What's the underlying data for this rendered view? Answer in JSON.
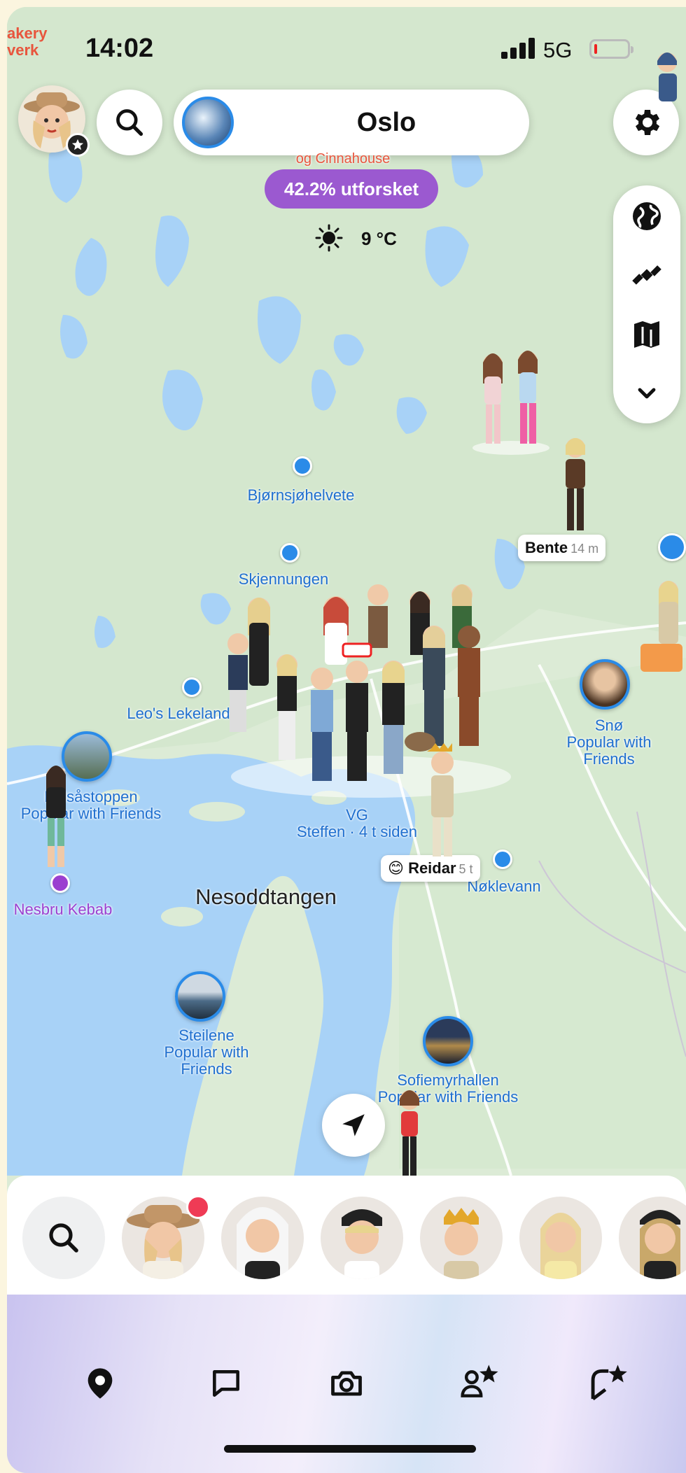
{
  "status_bar": {
    "time": "14:02",
    "network": "5G",
    "corner_label_line1": "akery",
    "corner_label_line2": "verk",
    "battery_level": 0.05,
    "battery_color": "#e22222"
  },
  "header": {
    "city": "Oslo",
    "partial_place_above": "og Cinnahouse",
    "explored_label": "42.2% utforsket",
    "explored_color": "#9b59d0",
    "weather_icon": "sun-icon",
    "temperature": "9 °C",
    "search_icon": "search-icon",
    "settings_icon": "gear-icon"
  },
  "map_tools": [
    {
      "icon": "globe-icon"
    },
    {
      "icon": "satellite-icon"
    },
    {
      "icon": "memories-map-icon"
    },
    {
      "icon": "chevron-down-icon"
    }
  ],
  "map_places": {
    "bjornsjohelvete": "Bjørnsjøhelvete",
    "skjennungen": "Skjennungen",
    "leos_lekeland": "Leo's Lekeland",
    "kolsastoppen_line1": "Kolsåstoppen",
    "kolsastoppen_line2": "Popular with Friends",
    "snoe_line1": "Snø",
    "snoe_line2": "Popular with",
    "snoe_line3": "Friends",
    "vg_line1": "VG",
    "vg_line2": "Steffen · 4 t siden",
    "nokkevann": "Nøklevann",
    "nesbru_kebab": "Nesbru Kebab",
    "nesoddtangen": "Nesoddtangen",
    "steilene_line1": "Steilene",
    "steilene_line2": "Popular with",
    "steilene_line3": "Friends",
    "sofiemyr_line1": "Sofiemyrhallen",
    "sofiemyr_line2": "Popular with Friends"
  },
  "map_friends": [
    {
      "name": "Bente",
      "time": "14 m"
    },
    {
      "name": "Reidar",
      "time": "5 t",
      "emoji": "😊"
    }
  ],
  "friends_bar": {
    "search_icon": "search-icon",
    "friends": [
      {
        "id": "friend-1",
        "has_notification": true
      },
      {
        "id": "friend-2"
      },
      {
        "id": "friend-3"
      },
      {
        "id": "friend-4"
      },
      {
        "id": "friend-5"
      },
      {
        "id": "friend-6"
      }
    ]
  },
  "tabs": [
    {
      "icon": "map-pin-icon",
      "active": true
    },
    {
      "icon": "chat-icon"
    },
    {
      "icon": "camera-icon"
    },
    {
      "icon": "friends-star-icon"
    },
    {
      "icon": "spotlight-star-icon"
    }
  ],
  "colors": {
    "map_land": "#dcebd6",
    "water": "#a8d2f7",
    "accent_blue": "#2a8be8"
  }
}
